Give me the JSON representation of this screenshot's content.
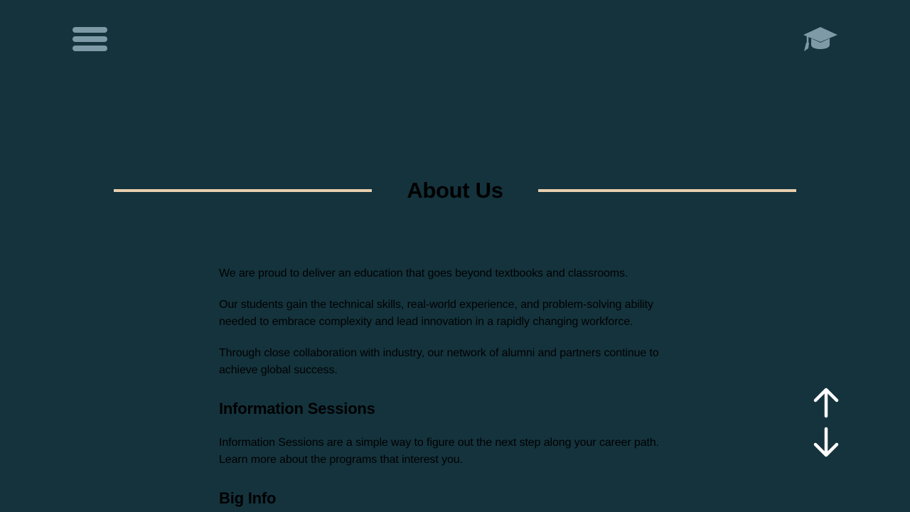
{
  "header": {
    "menu_icon": "hamburger-menu-icon",
    "logo_icon": "graduation-cap-icon"
  },
  "main": {
    "title": "About Us",
    "paragraphs": [
      "We are proud to deliver an education that goes beyond textbooks and classrooms.",
      "Our students gain the technical skills, real-world experience, and problem-solving ability needed to embrace complexity and lead innovation in a rapidly changing workforce.",
      "Through close collaboration with industry, our network of alumni and partners continue to achieve global success."
    ],
    "sections": [
      {
        "heading": "Information Sessions",
        "text": "Information Sessions are a simple way to figure out the next step along your career path. Learn more about the programs that interest you."
      },
      {
        "heading": "Big Info"
      }
    ]
  },
  "scroll": {
    "up_icon": "arrow-up-icon",
    "down_icon": "arrow-down-icon"
  },
  "colors": {
    "background": "#14333d",
    "accent_rule": "#e7cfae",
    "icon_muted": "#7e9aa6",
    "text": "#000000",
    "arrow": "#ffffff"
  }
}
